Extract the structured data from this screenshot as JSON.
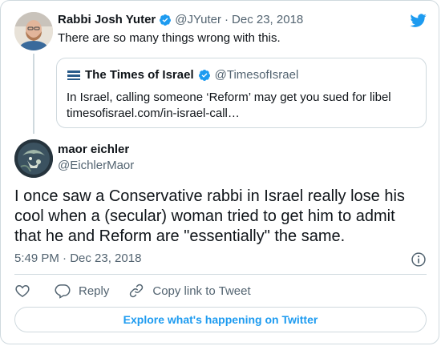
{
  "parent_tweet": {
    "author_name": "Rabbi Josh Yuter",
    "author_handle": "@JYuter",
    "separator": "·",
    "date": "Dec 23, 2018",
    "text": "There are so many things wrong with this."
  },
  "quoted_tweet": {
    "logo_text": "THE TIMES OF ISRAEL",
    "author_name": "The Times of Israel",
    "author_handle": "@TimesofIsrael",
    "text": "In Israel, calling someone ‘Reform’ may get you sued for libel",
    "link": "timesofisrael.com/in-israel-call…"
  },
  "main_tweet": {
    "author_name": "maor eichler",
    "author_handle": "@EichlerMaor",
    "text": "I once saw a Conservative rabbi in Israel really lose his cool when a (secular) woman tried to get him to admit that he and Reform are \"essentially\" the same.",
    "timestamp": "5:49 PM · Dec 23, 2018"
  },
  "actions": {
    "reply_label": "Reply",
    "copy_link_label": "Copy link to Tweet"
  },
  "explore_label": "Explore what's happening on Twitter",
  "colors": {
    "accent": "#1d9bf0",
    "text": "#0f1419",
    "secondary": "#536471",
    "border": "#cfd9de"
  },
  "icons": [
    "twitter-bird-icon",
    "verified-badge-icon",
    "info-icon",
    "heart-icon",
    "reply-icon",
    "link-icon"
  ]
}
